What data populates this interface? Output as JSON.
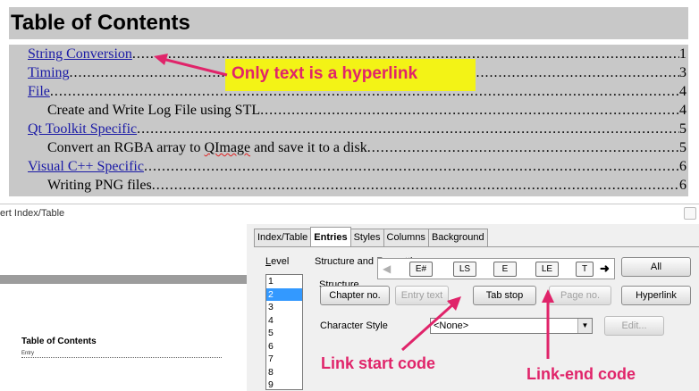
{
  "toc": {
    "heading": "Table of Contents",
    "entries": [
      {
        "text": "String Conversion",
        "page": "1",
        "level": 1,
        "link": true,
        "dots": "......................................................................................................................................................"
      },
      {
        "text": "Timing",
        "page": "3",
        "level": 1,
        "link": true,
        "dots": "..................................................................................................................................................................."
      },
      {
        "text": "File",
        "page": "4",
        "level": 1,
        "link": true,
        "dots": "......................................................................................................................................................................"
      },
      {
        "text": "Create and Write Log File using STL",
        "page": "4",
        "level": 2,
        "link": false,
        "dots": "....................................................................................................................."
      },
      {
        "text": "Qt Toolkit Specific",
        "page": "5",
        "level": 1,
        "link": true,
        "dots": "........................................................................................................................................................"
      },
      {
        "text_a": "Convert an RGBA array to ",
        "text_b": "QImage",
        "text_c": " and save it to a disk",
        "page": "5",
        "level": 2,
        "link": false,
        "dots": "......................................................................................................"
      },
      {
        "text": "Visual C++ Specific",
        "page": "6",
        "level": 1,
        "link": true,
        "dots": "......................................................................................................................................................"
      },
      {
        "text": "Writing PNG files",
        "page": "6",
        "level": 2,
        "link": false,
        "dots": "................................................................................................................................................."
      }
    ]
  },
  "callouts": {
    "hyperlink_note": "Only text is a hyperlink",
    "link_start": "Link start code",
    "link_end": "Link-end code"
  },
  "dialog": {
    "title": "ert Index/Table",
    "preview": {
      "title": "Table of Contents",
      "entry": "Entry"
    },
    "tabs": [
      {
        "label": "Index/Table",
        "active": false
      },
      {
        "label": "Entries",
        "active": true
      },
      {
        "label": "Styles",
        "active": false
      },
      {
        "label": "Columns",
        "active": false
      },
      {
        "label": "Background",
        "active": false
      }
    ],
    "level_label": "Level",
    "level_label_rest": "evel",
    "levels": [
      "1",
      "2",
      "3",
      "4",
      "5",
      "6",
      "7",
      "8",
      "9"
    ],
    "selected_level": "2",
    "structure_section": "Structure and Formatting",
    "structure_label": "Structure",
    "tokens": [
      "E#",
      "LS",
      "E",
      "LE",
      "T"
    ],
    "buttons": {
      "all": "All",
      "chapter_no": "Chapter no.",
      "entry_text": "Entry text",
      "tab_stop": "Tab stop",
      "page_no": "Page no.",
      "hyperlink": "Hyperlink",
      "edit": "Edit..."
    },
    "character_style_label": "Character Style",
    "character_style_value": "<None>"
  },
  "colors": {
    "annotation": "#e0246a",
    "highlight": "#f3f316",
    "link": "#1a1aa6",
    "toc_background": "#c8c8c8"
  }
}
